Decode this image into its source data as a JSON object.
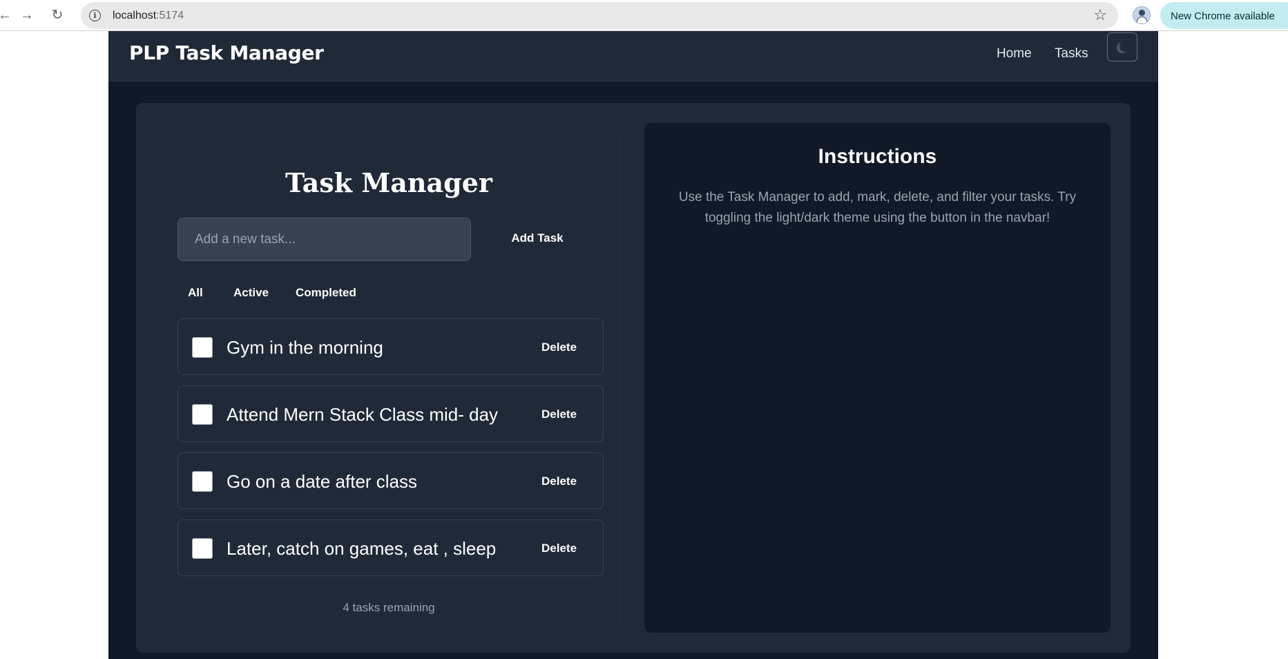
{
  "browser": {
    "url_host": "localhost",
    "url_port": ":5174",
    "update_label": "New Chrome available"
  },
  "app": {
    "brand": "PLP Task Manager",
    "nav": {
      "home": "Home",
      "tasks": "Tasks"
    }
  },
  "task_manager": {
    "title": "Task Manager",
    "input_placeholder": "Add a new task...",
    "add_label": "Add Task",
    "filters": [
      "All",
      "Active",
      "Completed"
    ],
    "tasks": [
      {
        "text": "Gym in the morning",
        "delete_label": "Delete",
        "completed": false
      },
      {
        "text": "Attend Mern Stack Class mid- day",
        "delete_label": "Delete",
        "completed": false
      },
      {
        "text": "Go on a date after class",
        "delete_label": "Delete",
        "completed": false
      },
      {
        "text": "Later, catch on games, eat , sleep",
        "delete_label": "Delete",
        "completed": false
      }
    ],
    "remaining": "4 tasks remaining"
  },
  "instructions": {
    "title": "Instructions",
    "text": "Use the Task Manager to add, mark, delete, and filter your tasks. Try toggling the light/dark theme using the button in the navbar!"
  },
  "colors": {
    "page_bg": "#111827",
    "card_bg": "#1f2937",
    "input_bg": "#374151",
    "text_muted": "#9ca3af"
  }
}
